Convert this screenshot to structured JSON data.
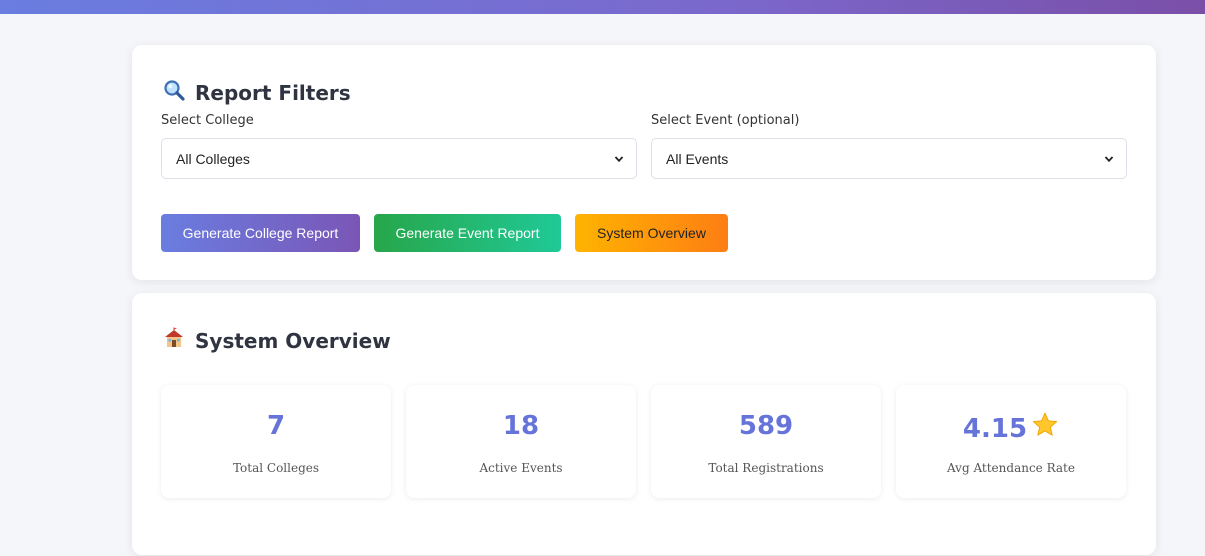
{
  "filters": {
    "title": "Report Filters",
    "title_icon": "magnifier-icon",
    "college_label": "Select College",
    "college_value": "All Colleges",
    "event_label": "Select Event (optional)",
    "event_value": "All Events"
  },
  "buttons": {
    "college_report": "Generate College Report",
    "event_report": "Generate Event Report",
    "system_overview": "System Overview"
  },
  "overview": {
    "title": "System Overview",
    "title_icon": "school-building-icon",
    "stats": [
      {
        "value": "7",
        "label": "Total Colleges"
      },
      {
        "value": "18",
        "label": "Active Events"
      },
      {
        "value": "589",
        "label": "Total Registrations"
      },
      {
        "value": "4.15",
        "label": "Avg Attendance Rate",
        "icon": "star-icon"
      }
    ]
  },
  "colors": {
    "accent": "#6674d9",
    "primary_gradient": [
      "#6a7de0",
      "#7a56b6"
    ],
    "success_gradient": [
      "#27a64a",
      "#20c997"
    ],
    "warning_gradient": [
      "#ffb300",
      "#fd7e14"
    ]
  }
}
